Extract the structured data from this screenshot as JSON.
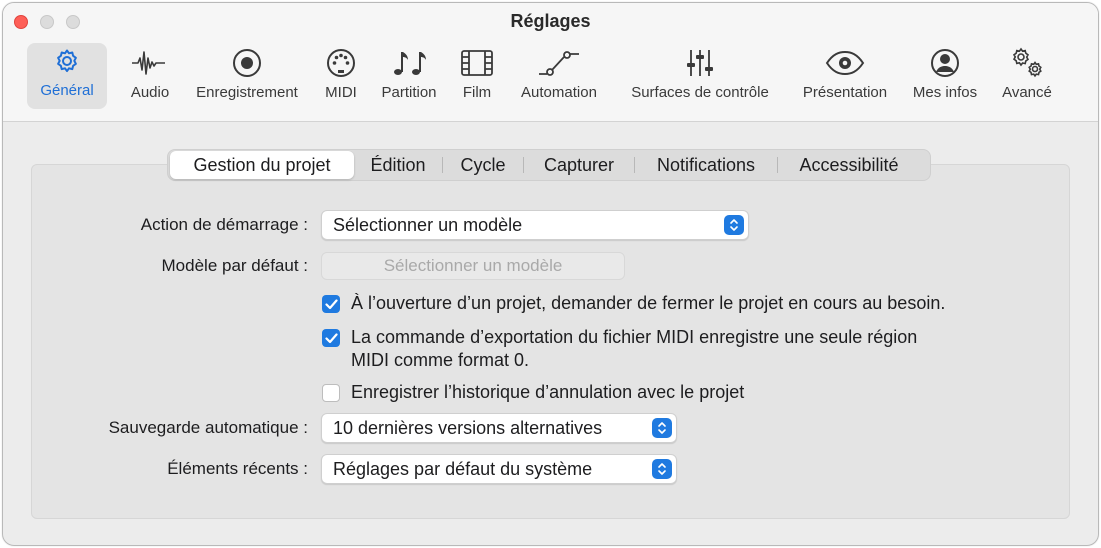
{
  "window": {
    "title": "Réglages"
  },
  "toolbar": {
    "items": [
      {
        "label": "Général",
        "icon": "gear-icon",
        "selected": true
      },
      {
        "label": "Audio",
        "icon": "waveform-icon"
      },
      {
        "label": "Enregistrement",
        "icon": "record-icon"
      },
      {
        "label": "MIDI",
        "icon": "midi-port-icon"
      },
      {
        "label": "Partition",
        "icon": "music-notes-icon"
      },
      {
        "label": "Film",
        "icon": "film-icon"
      },
      {
        "label": "Automation",
        "icon": "automation-curve-icon"
      },
      {
        "label": "Surfaces de contrôle",
        "icon": "sliders-icon"
      },
      {
        "label": "Présentation",
        "icon": "eye-icon"
      },
      {
        "label": "Mes infos",
        "icon": "person-icon"
      },
      {
        "label": "Avancé",
        "icon": "gears-icon"
      }
    ]
  },
  "tabs": {
    "items": [
      {
        "label": "Gestion du projet",
        "active": true
      },
      {
        "label": "Édition"
      },
      {
        "label": "Cycle"
      },
      {
        "label": "Capturer"
      },
      {
        "label": "Notifications"
      },
      {
        "label": "Accessibilité"
      }
    ]
  },
  "settings": {
    "startup_action": {
      "label": "Action de démarrage :",
      "value": "Sélectionner un modèle"
    },
    "default_template": {
      "label": "Modèle par défaut :",
      "button": "Sélectionner un modèle"
    },
    "checkboxes": [
      {
        "checked": true,
        "text": "À l’ouverture d’un projet, demander de fermer le projet en cours au besoin."
      },
      {
        "checked": true,
        "text_line1": "La commande d’exportation du fichier MIDI enregistre une seule région",
        "text_line2": "MIDI comme format 0."
      },
      {
        "checked": false,
        "text": "Enregistrer l’historique d’annulation avec le projet"
      }
    ],
    "autosave": {
      "label": "Sauvegarde automatique :",
      "value": "10 dernières versions alternatives"
    },
    "recent_items": {
      "label": "Éléments récents :",
      "value": "Réglages par défaut du système"
    }
  },
  "colors": {
    "accent": "#1f7ae0",
    "close": "#fe5f57"
  }
}
